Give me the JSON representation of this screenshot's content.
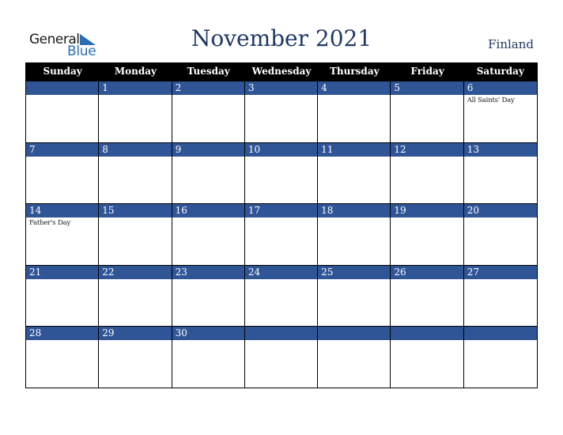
{
  "logo": {
    "word1": "General",
    "word2": "Blue",
    "accent_color": "#2a6db5"
  },
  "title": "November 2021",
  "country": "Finland",
  "colors": {
    "header_bg": "#000000",
    "daynum_bg": "#2f5597",
    "title_color": "#1f3864"
  },
  "weekdays": [
    "Sunday",
    "Monday",
    "Tuesday",
    "Wednesday",
    "Thursday",
    "Friday",
    "Saturday"
  ],
  "weeks": [
    [
      {
        "day": "",
        "event": ""
      },
      {
        "day": "1",
        "event": ""
      },
      {
        "day": "2",
        "event": ""
      },
      {
        "day": "3",
        "event": ""
      },
      {
        "day": "4",
        "event": ""
      },
      {
        "day": "5",
        "event": ""
      },
      {
        "day": "6",
        "event": "All Saints' Day"
      }
    ],
    [
      {
        "day": "7",
        "event": ""
      },
      {
        "day": "8",
        "event": ""
      },
      {
        "day": "9",
        "event": ""
      },
      {
        "day": "10",
        "event": ""
      },
      {
        "day": "11",
        "event": ""
      },
      {
        "day": "12",
        "event": ""
      },
      {
        "day": "13",
        "event": ""
      }
    ],
    [
      {
        "day": "14",
        "event": "Father's Day"
      },
      {
        "day": "15",
        "event": ""
      },
      {
        "day": "16",
        "event": ""
      },
      {
        "day": "17",
        "event": ""
      },
      {
        "day": "18",
        "event": ""
      },
      {
        "day": "19",
        "event": ""
      },
      {
        "day": "20",
        "event": ""
      }
    ],
    [
      {
        "day": "21",
        "event": ""
      },
      {
        "day": "22",
        "event": ""
      },
      {
        "day": "23",
        "event": ""
      },
      {
        "day": "24",
        "event": ""
      },
      {
        "day": "25",
        "event": ""
      },
      {
        "day": "26",
        "event": ""
      },
      {
        "day": "27",
        "event": ""
      }
    ],
    [
      {
        "day": "28",
        "event": ""
      },
      {
        "day": "29",
        "event": ""
      },
      {
        "day": "30",
        "event": ""
      },
      {
        "day": "",
        "event": ""
      },
      {
        "day": "",
        "event": ""
      },
      {
        "day": "",
        "event": ""
      },
      {
        "day": "",
        "event": ""
      }
    ]
  ]
}
